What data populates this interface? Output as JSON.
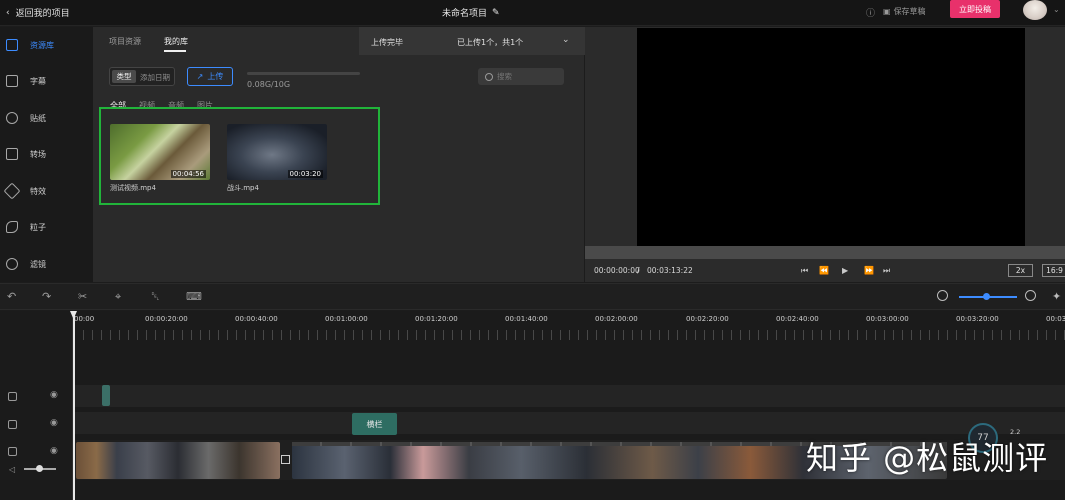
{
  "topbar": {
    "back_label": "返回我的项目",
    "project_title": "未命名项目",
    "save_draft": "保存草稿",
    "publish": "立即投稿"
  },
  "nav": {
    "items": [
      {
        "label": "资源库",
        "icon": "cube-icon",
        "active": true
      },
      {
        "label": "字幕",
        "icon": "text-icon"
      },
      {
        "label": "贴纸",
        "icon": "sticker-icon"
      },
      {
        "label": "转场",
        "icon": "transition-icon"
      },
      {
        "label": "特效",
        "icon": "effects-icon"
      },
      {
        "label": "粒子",
        "icon": "particle-icon"
      },
      {
        "label": "滤镜",
        "icon": "filter-icon"
      }
    ]
  },
  "library": {
    "tabs": [
      "项目资源",
      "我的库"
    ],
    "active_tab": "我的库",
    "upload_status": "上传完毕",
    "upload_count": "已上传1个，共1个",
    "sort": {
      "type": "类型",
      "date": "添加日期"
    },
    "upload_button": "上传",
    "storage": "0.08G/10G",
    "storage_used_fraction": 0.008,
    "search_placeholder": "搜索",
    "filters": [
      "全部",
      "视频",
      "音频",
      "图片"
    ],
    "items": [
      {
        "name": "测试视频.mp4",
        "duration": "00:04:56"
      },
      {
        "name": "战斗.mp4",
        "duration": "00:03:20"
      }
    ]
  },
  "preview": {
    "current_time": "00:00:00:00",
    "separator": "/",
    "total_time": "00:03:13:22",
    "speed": "2x",
    "ratio": "16:9"
  },
  "timeline": {
    "ruler": [
      "00:00",
      "00:00:20:00",
      "00:00:40:00",
      "00:01:00:00",
      "00:01:20:00",
      "00:01:40:00",
      "00:02:00:00",
      "00:02:20:00",
      "00:02:40:00",
      "00:03:00:00",
      "00:03:20:00",
      "00:03"
    ],
    "text_clip": "横栏"
  },
  "overlay": {
    "gauge_value": "77",
    "net_speed": "2.2",
    "watermark": "知乎 @松鼠测评"
  },
  "colors": {
    "accent": "#3d8cff",
    "publish": "#e8316b",
    "highlight": "#21b43a"
  }
}
